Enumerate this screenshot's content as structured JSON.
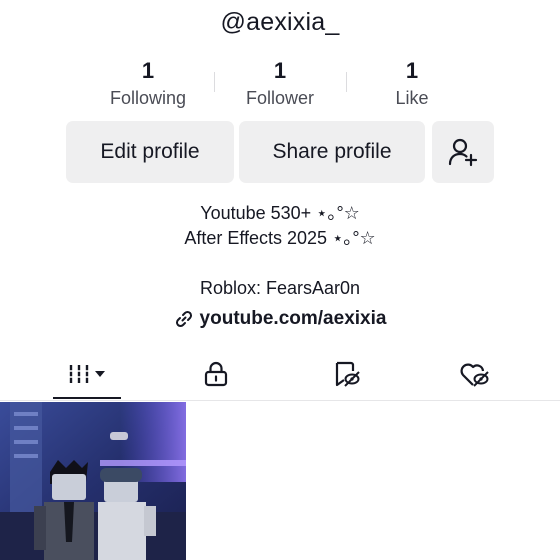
{
  "profile": {
    "username": "@aexixia_"
  },
  "stats": [
    {
      "value": "1",
      "label": "Following"
    },
    {
      "value": "1",
      "label": "Follower"
    },
    {
      "value": "1",
      "label": "Like"
    }
  ],
  "actions": {
    "edit_label": "Edit profile",
    "share_label": "Share profile",
    "add_friend_icon": "add-user-icon"
  },
  "bio": {
    "line1": "Youtube 530+ ⋆｡°☆",
    "line2": "After Effects 2025 ⋆｡°☆",
    "line3": "Roblox: FearsAar0n",
    "link": "youtube.com/aexixia"
  },
  "tabs": [
    {
      "name": "videos",
      "icon": "grid-icon",
      "active": true
    },
    {
      "name": "private",
      "icon": "lock-icon",
      "active": false
    },
    {
      "name": "reposts",
      "icon": "repost-icon",
      "active": false
    },
    {
      "name": "liked",
      "icon": "heart-hidden-icon",
      "active": false
    }
  ],
  "colors": {
    "text": "#161823",
    "button_bg": "#efeff0",
    "secondary_text": "#4a4c55"
  }
}
